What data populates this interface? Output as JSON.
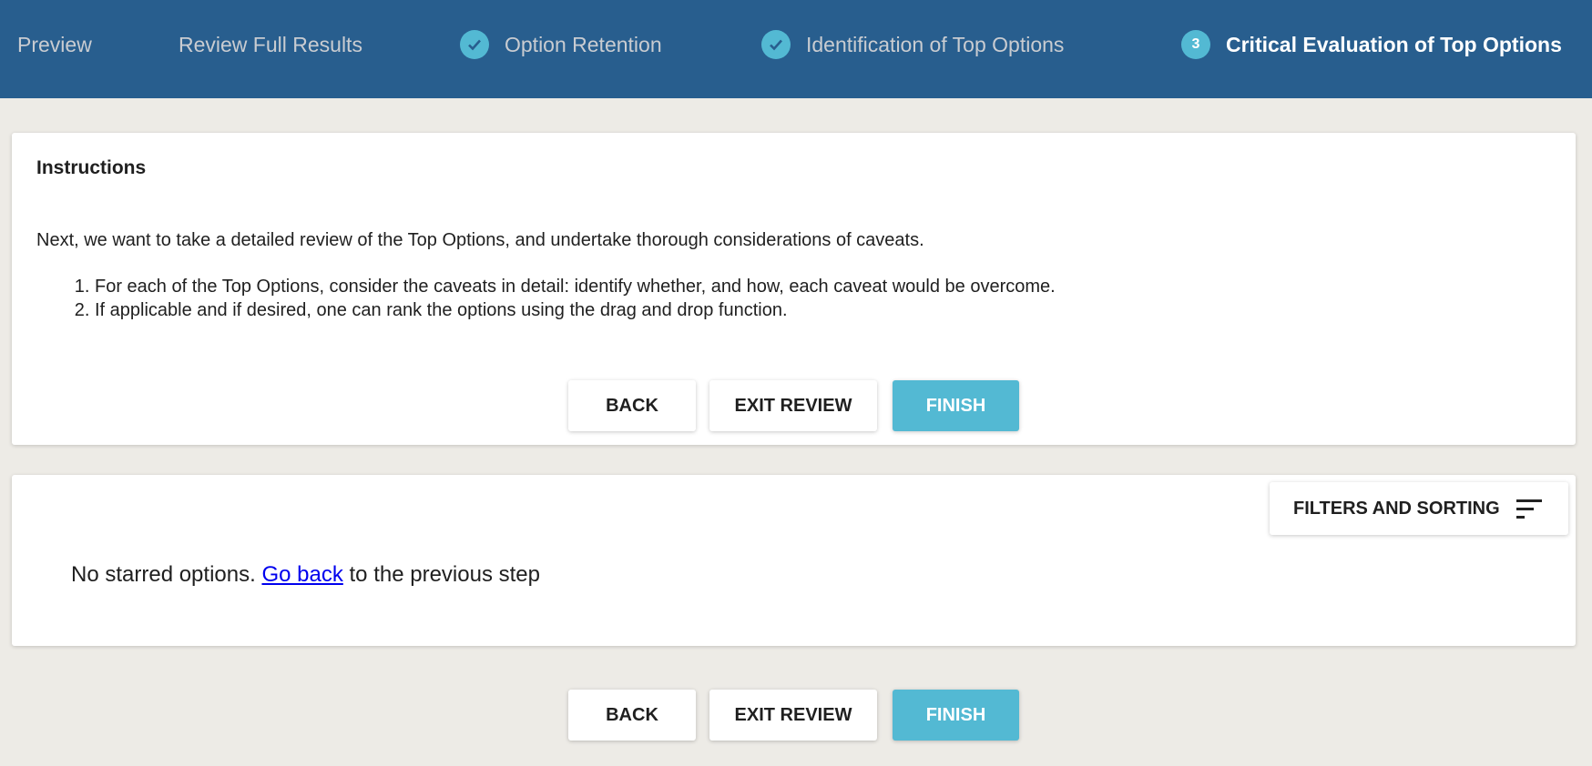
{
  "stepper": {
    "steps": [
      {
        "label": "Preview",
        "state": "inactive"
      },
      {
        "label": "Review Full Results",
        "state": "inactive"
      },
      {
        "label": "Option Retention",
        "state": "completed",
        "icon": "check-icon"
      },
      {
        "label": "Identification of Top Options",
        "state": "completed",
        "icon": "check-icon"
      },
      {
        "label": "Critical Evaluation of Top Options",
        "state": "active",
        "number": "3"
      }
    ]
  },
  "instructions": {
    "title": "Instructions",
    "intro": "Next, we want to take a detailed review of the Top Options, and undertake thorough considerations of caveats.",
    "items": [
      "For each of the Top Options, consider the caveats in detail: identify whether, and how, each caveat would be overcome.",
      "If applicable and if desired, one can rank the options using the drag and drop function."
    ]
  },
  "buttons": {
    "back": "BACK",
    "exit": "EXIT REVIEW",
    "finish": "FINISH"
  },
  "results": {
    "filters_label": "FILTERS AND SORTING",
    "empty_text": "No starred options.",
    "go_back_link": "Go back",
    "empty_suffix": "to the previous step"
  },
  "colors": {
    "header": "#285e8e",
    "accent": "#53b9d3",
    "background": "#edebe6"
  }
}
